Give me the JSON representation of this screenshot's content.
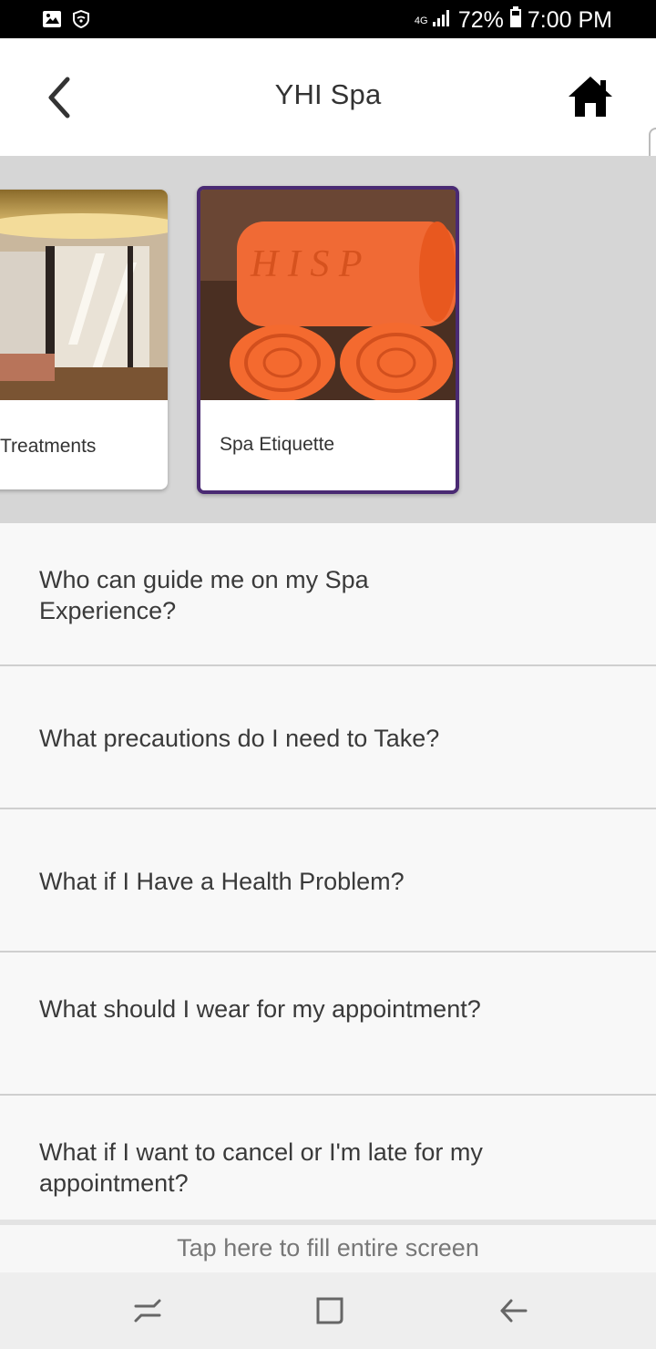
{
  "status_bar": {
    "network_type": "4G",
    "battery": "72%",
    "time": "7:00 PM",
    "icons": [
      "image-icon",
      "wifi-shield-icon",
      "data-arrows-icon",
      "signal-icon",
      "battery-icon"
    ]
  },
  "app_bar": {
    "title": "YHI Spa",
    "back_icon": "chevron-left-icon",
    "home_icon": "home-icon"
  },
  "carousel": {
    "cards": [
      {
        "label": "Treatments",
        "image": "spa-room-photo",
        "selected": false
      },
      {
        "label": "Spa Etiquette",
        "image": "orange-towels-photo",
        "selected": true
      }
    ],
    "selected_color": "#4a2a73"
  },
  "faq": {
    "items": [
      "Who can guide me on my Spa Experience?",
      "What precautions do I need to Take?",
      "What if I Have a Health Problem?",
      "What should I wear for my appointment?",
      "What if I want to cancel or I'm late for my appointment?"
    ]
  },
  "banner": {
    "text": "Tap here to fill entire screen"
  },
  "nav_bar": {
    "icons": [
      "recents-icon",
      "home-square-icon",
      "back-arrow-icon"
    ]
  }
}
